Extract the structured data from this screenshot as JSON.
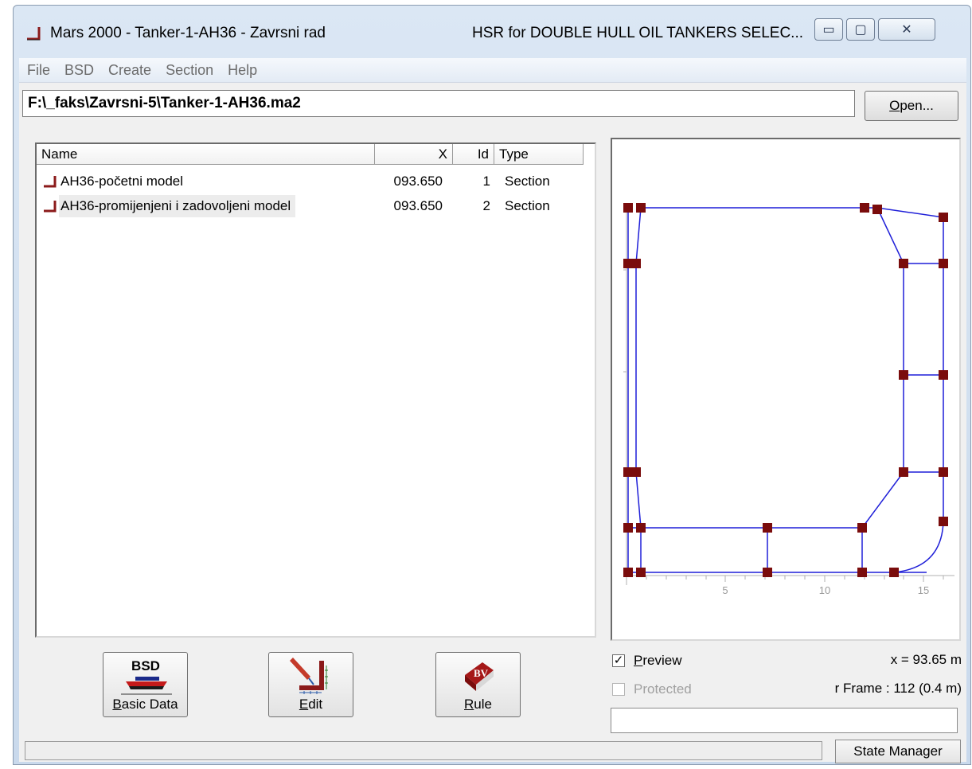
{
  "window": {
    "title": "Mars 2000 - Tanker-1-AH36 - Zavrsni rad",
    "subtitle": "HSR for DOUBLE HULL OIL TANKERS SELEC...",
    "controls": {
      "minimize": "▭",
      "maximize": "▢",
      "close": "✕"
    }
  },
  "menu": [
    "File",
    "BSD",
    "Create",
    "Section",
    "Help"
  ],
  "file_path": "F:\\_faks\\Zavrsni-5\\Tanker-1-AH36.ma2",
  "open_button": {
    "prefix": "O",
    "rest": "pen..."
  },
  "list": {
    "columns": {
      "name": "Name",
      "x": "X",
      "id": "Id",
      "type": "Type"
    },
    "rows": [
      {
        "name": "AH36-početni model",
        "x": "093.650",
        "id": "1",
        "type": "Section",
        "selected": false
      },
      {
        "name": "AH36-promijenjeni i zadovoljeni model",
        "x": "093.650",
        "id": "2",
        "type": "Section",
        "selected": true
      }
    ]
  },
  "buttons": {
    "basic_data": {
      "icon_text": "BSD",
      "u": "B",
      "rest": "asic Data"
    },
    "edit": {
      "u": "E",
      "rest": "dit"
    },
    "rule": {
      "icon_text": "BV",
      "u": "R",
      "rest": "ule"
    }
  },
  "preview_checkbox": {
    "u": "P",
    "rest": "review",
    "checked": true
  },
  "protected_checkbox": {
    "label": "Protected",
    "checked": false
  },
  "x_value": "x = 93.65 m",
  "frame_value": "r Frame : 112 (0.4 m)",
  "state_manager": "State Manager",
  "chart_axis_ticks": [
    "5",
    "10",
    "15"
  ],
  "colors": {
    "section_line": "#1f1fd8",
    "node": "#7a0c0c",
    "title_bg": "#c9d9ec"
  }
}
